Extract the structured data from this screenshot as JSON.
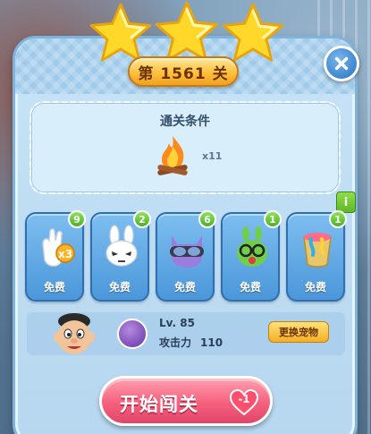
{
  "level": {
    "title": "第 1561 关",
    "stars": 3
  },
  "objective": {
    "title": "通关条件",
    "goal_icon": "campfire-icon",
    "goal_count": "x11"
  },
  "boosters": [
    {
      "icon": "glove-x3-icon",
      "label": "免费",
      "count": "9"
    },
    {
      "icon": "white-bunny-icon",
      "label": "免费",
      "count": "2"
    },
    {
      "icon": "purple-cat-goggles-icon",
      "label": "免费",
      "count": "6"
    },
    {
      "icon": "green-frog-icon",
      "label": "免费",
      "count": "1"
    },
    {
      "icon": "paint-bucket-icon",
      "label": "免费",
      "count": "1"
    }
  ],
  "pet": {
    "level": "Lv. 85",
    "attack_label": "攻击力",
    "attack_value": "110",
    "change_button": "更换宠物"
  },
  "start": {
    "label": "开始闯关",
    "cost": "-1"
  },
  "info_label": "i",
  "colors": {
    "panel": "#c7e3f6",
    "badge": "#ffc03d",
    "booster": "#4b97da",
    "start": "#f5607c",
    "count_badge": "#4fae26"
  }
}
